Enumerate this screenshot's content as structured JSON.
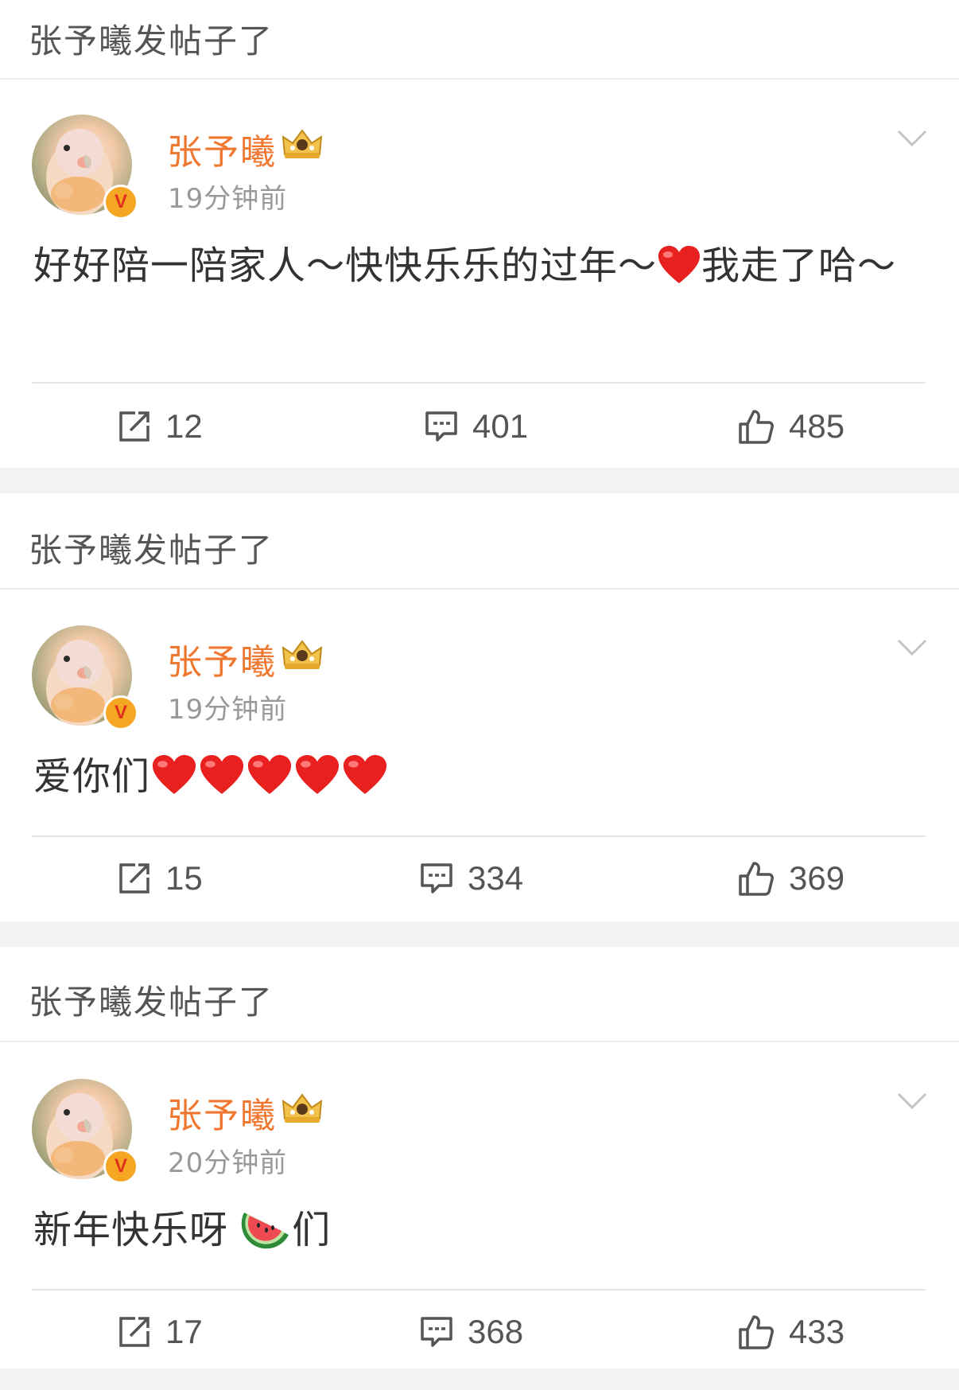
{
  "posts": [
    {
      "header": "张予曦发帖子了",
      "author": "张予曦",
      "time": "19分钟前",
      "text": "好好陪一陪家人～快快乐乐的过年～❤️我走了哈～",
      "text_parts": [
        "好好陪一陪家人～快快乐乐的过年～",
        "我走了哈～"
      ],
      "repost": "12",
      "comment": "401",
      "like": "485"
    },
    {
      "header": "张予曦发帖子了",
      "author": "张予曦",
      "time": "19分钟前",
      "text": "爱你们❤️❤️❤️❤️❤️",
      "text_parts": [
        "爱你们"
      ],
      "repost": "15",
      "comment": "334",
      "like": "369"
    },
    {
      "header": "张予曦发帖子了",
      "author": "张予曦",
      "time": "20分钟前",
      "text": "新年快乐呀🍉们",
      "text_parts": [
        "新年快乐呀",
        "们"
      ],
      "repost": "17",
      "comment": "368",
      "like": "433"
    }
  ],
  "icons": {
    "verified": "V",
    "crown": "crown-icon",
    "menu": "chevron-down-icon",
    "repost": "repost-icon",
    "comment": "comment-icon",
    "like": "thumbs-up-icon"
  },
  "colors": {
    "name": "#f0772f",
    "header_text": "#555555",
    "time": "#999999",
    "body_text": "#333333",
    "gap": "#f2f2f2",
    "verified_badge": "#f5a623"
  }
}
